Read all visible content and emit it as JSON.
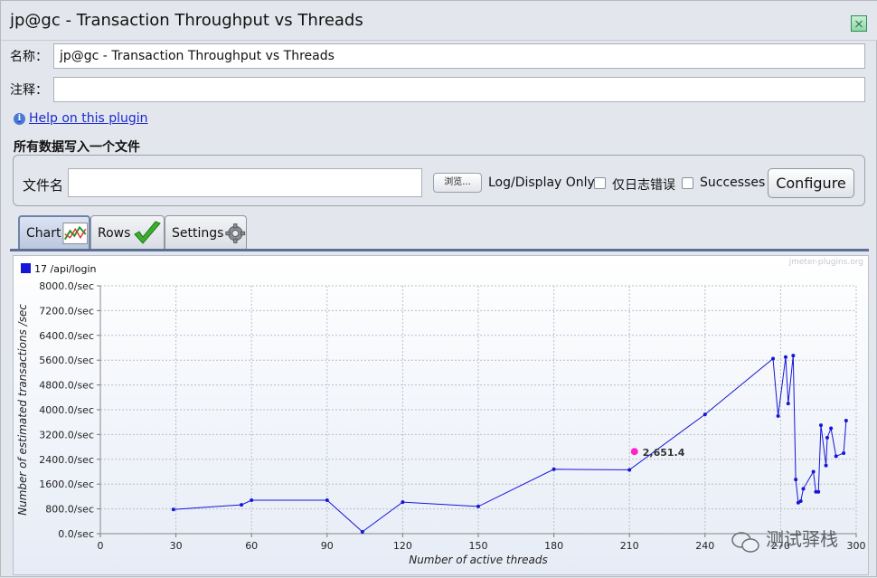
{
  "window": {
    "title": "jp@gc - Transaction Throughput vs Threads"
  },
  "form": {
    "name_label": "名称：",
    "name_value": "jp@gc - Transaction Throughput vs Threads",
    "comment_label": "注释：",
    "comment_value": "",
    "help_link": "Help on this plugin"
  },
  "file_section": {
    "title": "所有数据写入一个文件",
    "filename_label": "文件名",
    "filename_value": "",
    "browse_label": "浏览...",
    "log_display_label": "Log/Display Only:",
    "errors_label": "仅日志错误",
    "successes_label": "Successes",
    "configure_label": "Configure"
  },
  "tabs": [
    {
      "label": "Chart",
      "icon": "chart-icon",
      "active": true
    },
    {
      "label": "Rows",
      "icon": "checkmark-icon",
      "active": false
    },
    {
      "label": "Settings",
      "icon": "gear-icon",
      "active": false
    }
  ],
  "watermark": "jmeter-plugins.org",
  "overlay_watermark": "测试驿栈",
  "chart_data": {
    "type": "line",
    "xlabel": "Number of active threads",
    "ylabel": "Number of estimated transactions /sec",
    "xlim": [
      0,
      300
    ],
    "ylim": [
      0,
      8000
    ],
    "x_ticks": [
      0,
      30,
      60,
      90,
      120,
      150,
      180,
      210,
      240,
      270,
      300
    ],
    "x_tick_labels": [
      "0",
      "30",
      "60",
      "90",
      "120",
      "150",
      "180",
      "210",
      "240",
      "270",
      "300"
    ],
    "y_ticks": [
      0,
      800,
      1600,
      2400,
      3200,
      4000,
      4800,
      5600,
      6400,
      7200,
      8000
    ],
    "y_tick_labels": [
      "0.0/sec",
      "800.0/sec",
      "1600.0/sec",
      "2400.0/sec",
      "3200.0/sec",
      "4000.0/sec",
      "4800.0/sec",
      "5600.0/sec",
      "6400.0/sec",
      "7200.0/sec",
      "8000.0/sec"
    ],
    "grid": true,
    "legend_position": "top-left",
    "series": [
      {
        "name": "17 /api/login",
        "color": "#1616d6",
        "points": [
          [
            29,
            780
          ],
          [
            56,
            930
          ],
          [
            60,
            1080
          ],
          [
            90,
            1080
          ],
          [
            104,
            60
          ],
          [
            120,
            1020
          ],
          [
            150,
            880
          ],
          [
            180,
            2080
          ],
          [
            210,
            2060
          ],
          [
            240,
            3850
          ],
          [
            267,
            5650
          ],
          [
            269,
            3800
          ],
          [
            272,
            5700
          ],
          [
            273,
            4200
          ],
          [
            275,
            5750
          ],
          [
            276,
            1750
          ],
          [
            277,
            1000
          ],
          [
            278,
            1050
          ],
          [
            279,
            1450
          ],
          [
            283,
            2000
          ],
          [
            284,
            1350
          ],
          [
            285,
            1350
          ],
          [
            286,
            3500
          ],
          [
            288,
            2200
          ],
          [
            288.5,
            3100
          ],
          [
            290,
            3400
          ],
          [
            292,
            2500
          ],
          [
            295,
            2600
          ],
          [
            296,
            3650
          ]
        ]
      }
    ],
    "highlight": {
      "x": 212,
      "y": 2651.4,
      "label": "2,651.4",
      "color": "#ff22cc"
    }
  }
}
